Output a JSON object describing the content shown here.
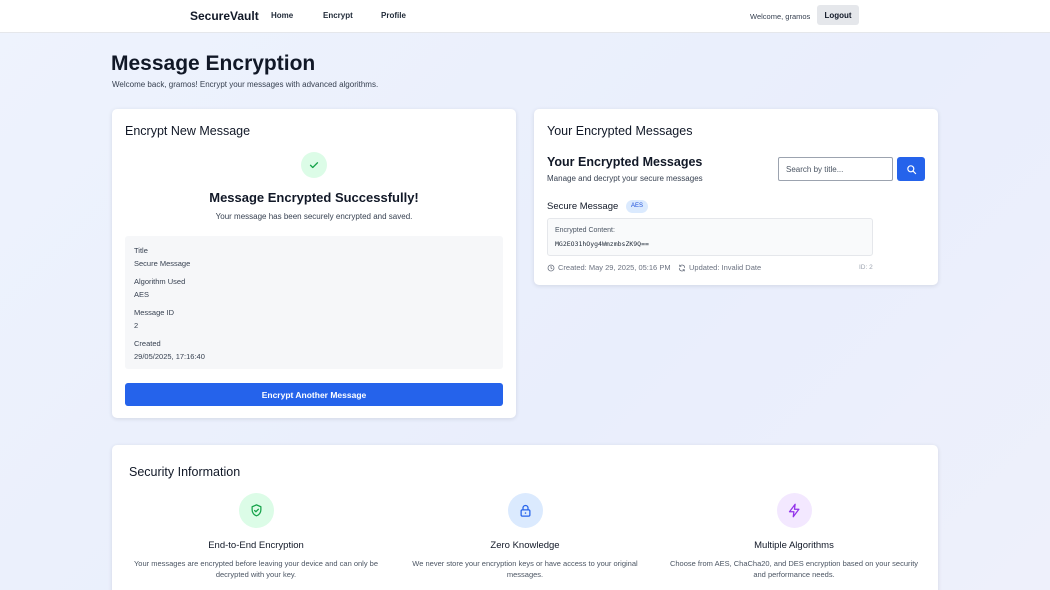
{
  "nav": {
    "brand": "SecureVault",
    "links": [
      "Home",
      "Encrypt",
      "Profile"
    ],
    "welcome": "Welcome, gramos",
    "logout": "Logout"
  },
  "header": {
    "title": "Message Encryption",
    "subtitle": "Welcome back, gramos! Encrypt your messages with advanced algorithms."
  },
  "encrypt_card": {
    "title": "Encrypt New Message",
    "success_title": "Message Encrypted Successfully!",
    "success_subtitle": "Your message has been securely encrypted and saved.",
    "details": [
      {
        "label": "Title",
        "value": "Secure Message"
      },
      {
        "label": "Algorithm Used",
        "value": "AES"
      },
      {
        "label": "Message ID",
        "value": "2"
      },
      {
        "label": "Created",
        "value": "29/05/2025, 17:16:40"
      }
    ],
    "button": "Encrypt Another Message"
  },
  "messages_card": {
    "title": "Your Encrypted Messages",
    "list_title": "Your Encrypted Messages",
    "list_subtitle": "Manage and decrypt your secure messages",
    "search_placeholder": "Search by title...",
    "message": {
      "title": "Secure Message",
      "algorithm": "AES",
      "content_label": "Encrypted Content:",
      "content": "MG2EO31hOyg4WmzmbsZK9Q==",
      "created": "Created: May 29, 2025, 05:16 PM",
      "updated": "Updated: Invalid Date",
      "id": "ID: 2"
    }
  },
  "security": {
    "title": "Security Information",
    "features": [
      {
        "icon": "shield-check-icon",
        "title": "End-to-End Encryption",
        "description": "Your messages are encrypted before leaving your device and can only be decrypted with your key.",
        "color": "#16a34a",
        "bg": "#dcfce7"
      },
      {
        "icon": "lock-icon",
        "title": "Zero Knowledge",
        "description": "We never store your encryption keys or have access to your original messages.",
        "color": "#2563eb",
        "bg": "#dbeafe"
      },
      {
        "icon": "lightning-icon",
        "title": "Multiple Algorithms",
        "description": "Choose from AES, ChaCha20, and DES encryption based on your security and performance needs.",
        "color": "#9333ea",
        "bg": "#f3e8ff"
      }
    ]
  },
  "colors": {
    "primary": "#2563eb",
    "success": "#16a34a",
    "accent_purple": "#9333ea"
  }
}
